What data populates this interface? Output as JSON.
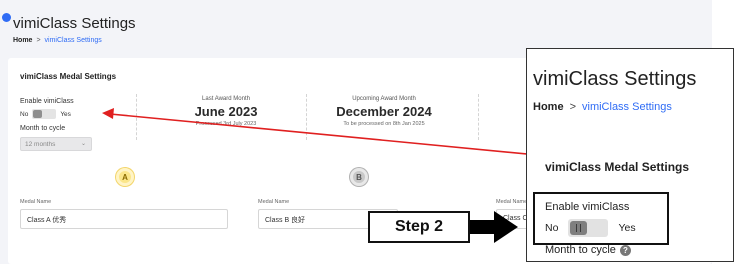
{
  "page": {
    "title": "vimiClass Settings",
    "breadcrumb": {
      "home": "Home",
      "separator": ">",
      "current": "vimiClass Settings"
    }
  },
  "medal_settings": {
    "title": "vimiClass Medal Settings",
    "enable_label": "Enable vimiClass",
    "toggle_no": "No",
    "toggle_yes": "Yes",
    "toggle_on": false,
    "month_label": "Month to cycle",
    "month_value": "12 months"
  },
  "awards": {
    "last": {
      "label": "Last Award Month",
      "value": "June 2023",
      "note": "Processed 3rd July 2023"
    },
    "upcoming": {
      "label": "Upcoming Award Month",
      "value": "December 2024",
      "note": "To be processed on 8th Jan 2025"
    }
  },
  "medals": [
    {
      "badge": "A",
      "name_label": "Medal Name",
      "name_value": "Class A 优秀"
    },
    {
      "badge": "B",
      "name_label": "Medal Name",
      "name_value": "Class B 良好"
    },
    {
      "name_label": "Medal Name",
      "name_value": "Class C"
    }
  ],
  "callout": {
    "title": "vimiClass Settings",
    "breadcrumb_home": "Home",
    "breadcrumb_separator": ">",
    "breadcrumb_current": "vimiClass Settings",
    "card_title": "vimiClass Medal Settings",
    "enable_label": "Enable vimiClass",
    "toggle_no": "No",
    "toggle_yes": "Yes",
    "month_label": "Month to cycle",
    "help_glyph": "?"
  },
  "step_label": "Step 2",
  "colors": {
    "accent": "#2f6cf5",
    "arrow": "#e02020",
    "gold": "#fbe68a",
    "silver": "#c8c8c8"
  },
  "icons": [
    "chevron-right-icon",
    "chevron-down-icon",
    "help-icon",
    "medal-gold-icon",
    "medal-silver-icon",
    "arrow-right-icon"
  ]
}
